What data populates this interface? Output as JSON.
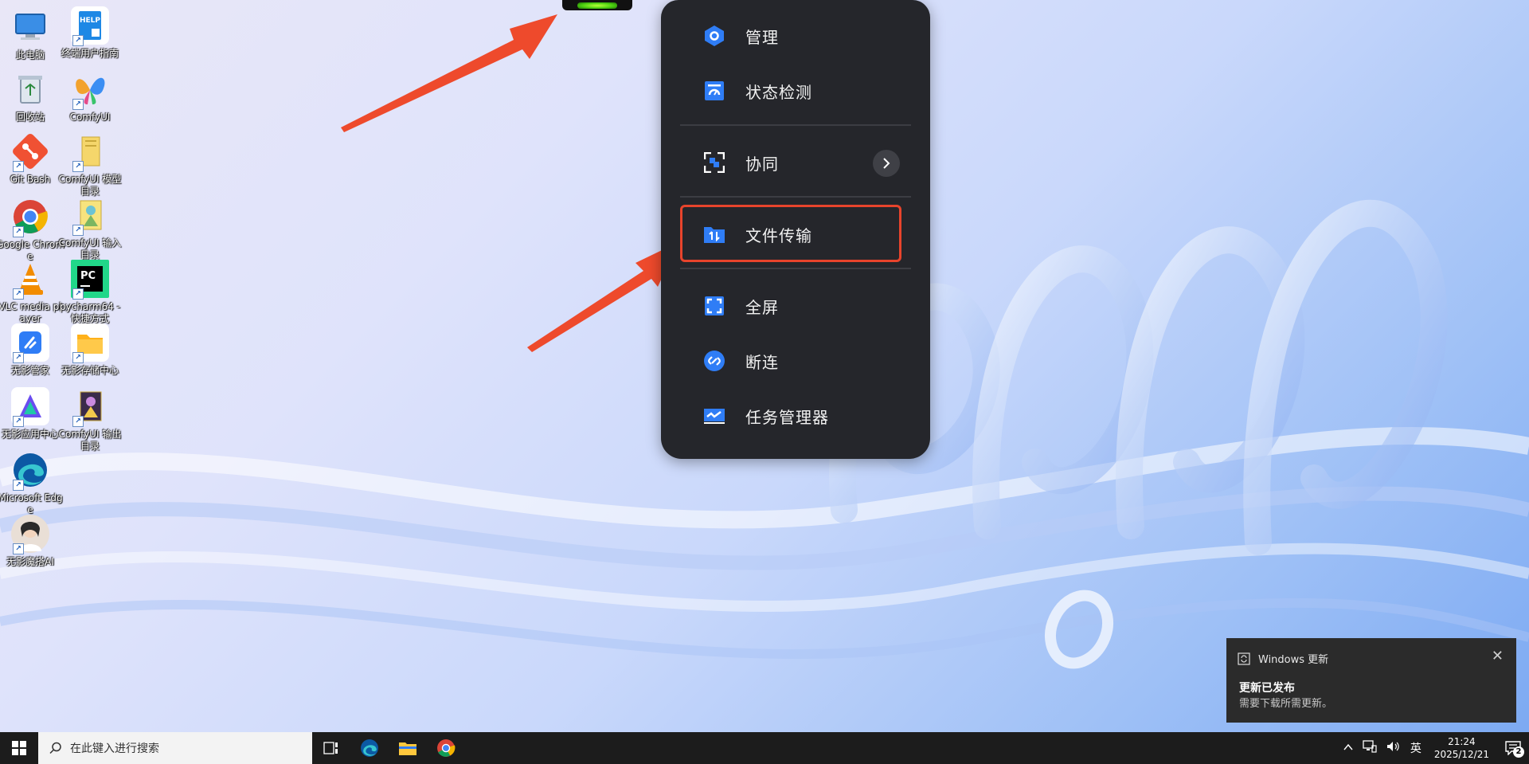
{
  "desktop": {
    "icons": [
      {
        "label": "此电脑"
      },
      {
        "label": "终端用户指南"
      },
      {
        "label": "回收站"
      },
      {
        "label": "ComfyUI"
      },
      {
        "label": "Git Bash"
      },
      {
        "label": "ComfyUI 模型目录"
      },
      {
        "label": "Google Chrome"
      },
      {
        "label": "ComfyUI 输入目录"
      },
      {
        "label": "VLC media player"
      },
      {
        "label": "pycharm64 - 快捷方式"
      },
      {
        "label": "无影管家"
      },
      {
        "label": "无影存储中心"
      },
      {
        "label": "无影应用中心"
      },
      {
        "label": "ComfyUI 输出目录"
      },
      {
        "label": "Microsoft Edge"
      },
      {
        "label": "无影魔搭AI"
      }
    ]
  },
  "menu": {
    "items": [
      {
        "label": "管理",
        "icon": "manage-icon"
      },
      {
        "label": "状态检测",
        "icon": "status-check-icon"
      },
      {
        "label": "协同",
        "icon": "collaborate-icon"
      },
      {
        "label": "文件传输",
        "icon": "file-transfer-icon"
      },
      {
        "label": "全屏",
        "icon": "fullscreen-icon"
      },
      {
        "label": "断连",
        "icon": "disconnect-icon"
      },
      {
        "label": "任务管理器",
        "icon": "task-manager-icon"
      }
    ]
  },
  "toast": {
    "app": "Windows 更新",
    "title": "更新已发布",
    "body": "需要下载所需更新。",
    "close": "✕"
  },
  "taskbar": {
    "search_placeholder": "在此键入进行搜索",
    "ime": "英",
    "time": "21:24",
    "date": "2025/12/21",
    "notification_count": "2"
  },
  "colors": {
    "menu_bg": "#25262b",
    "accent_blue": "#2f7df6",
    "highlight_red": "#e8442c",
    "taskbar_bg": "#1c1c1c"
  }
}
